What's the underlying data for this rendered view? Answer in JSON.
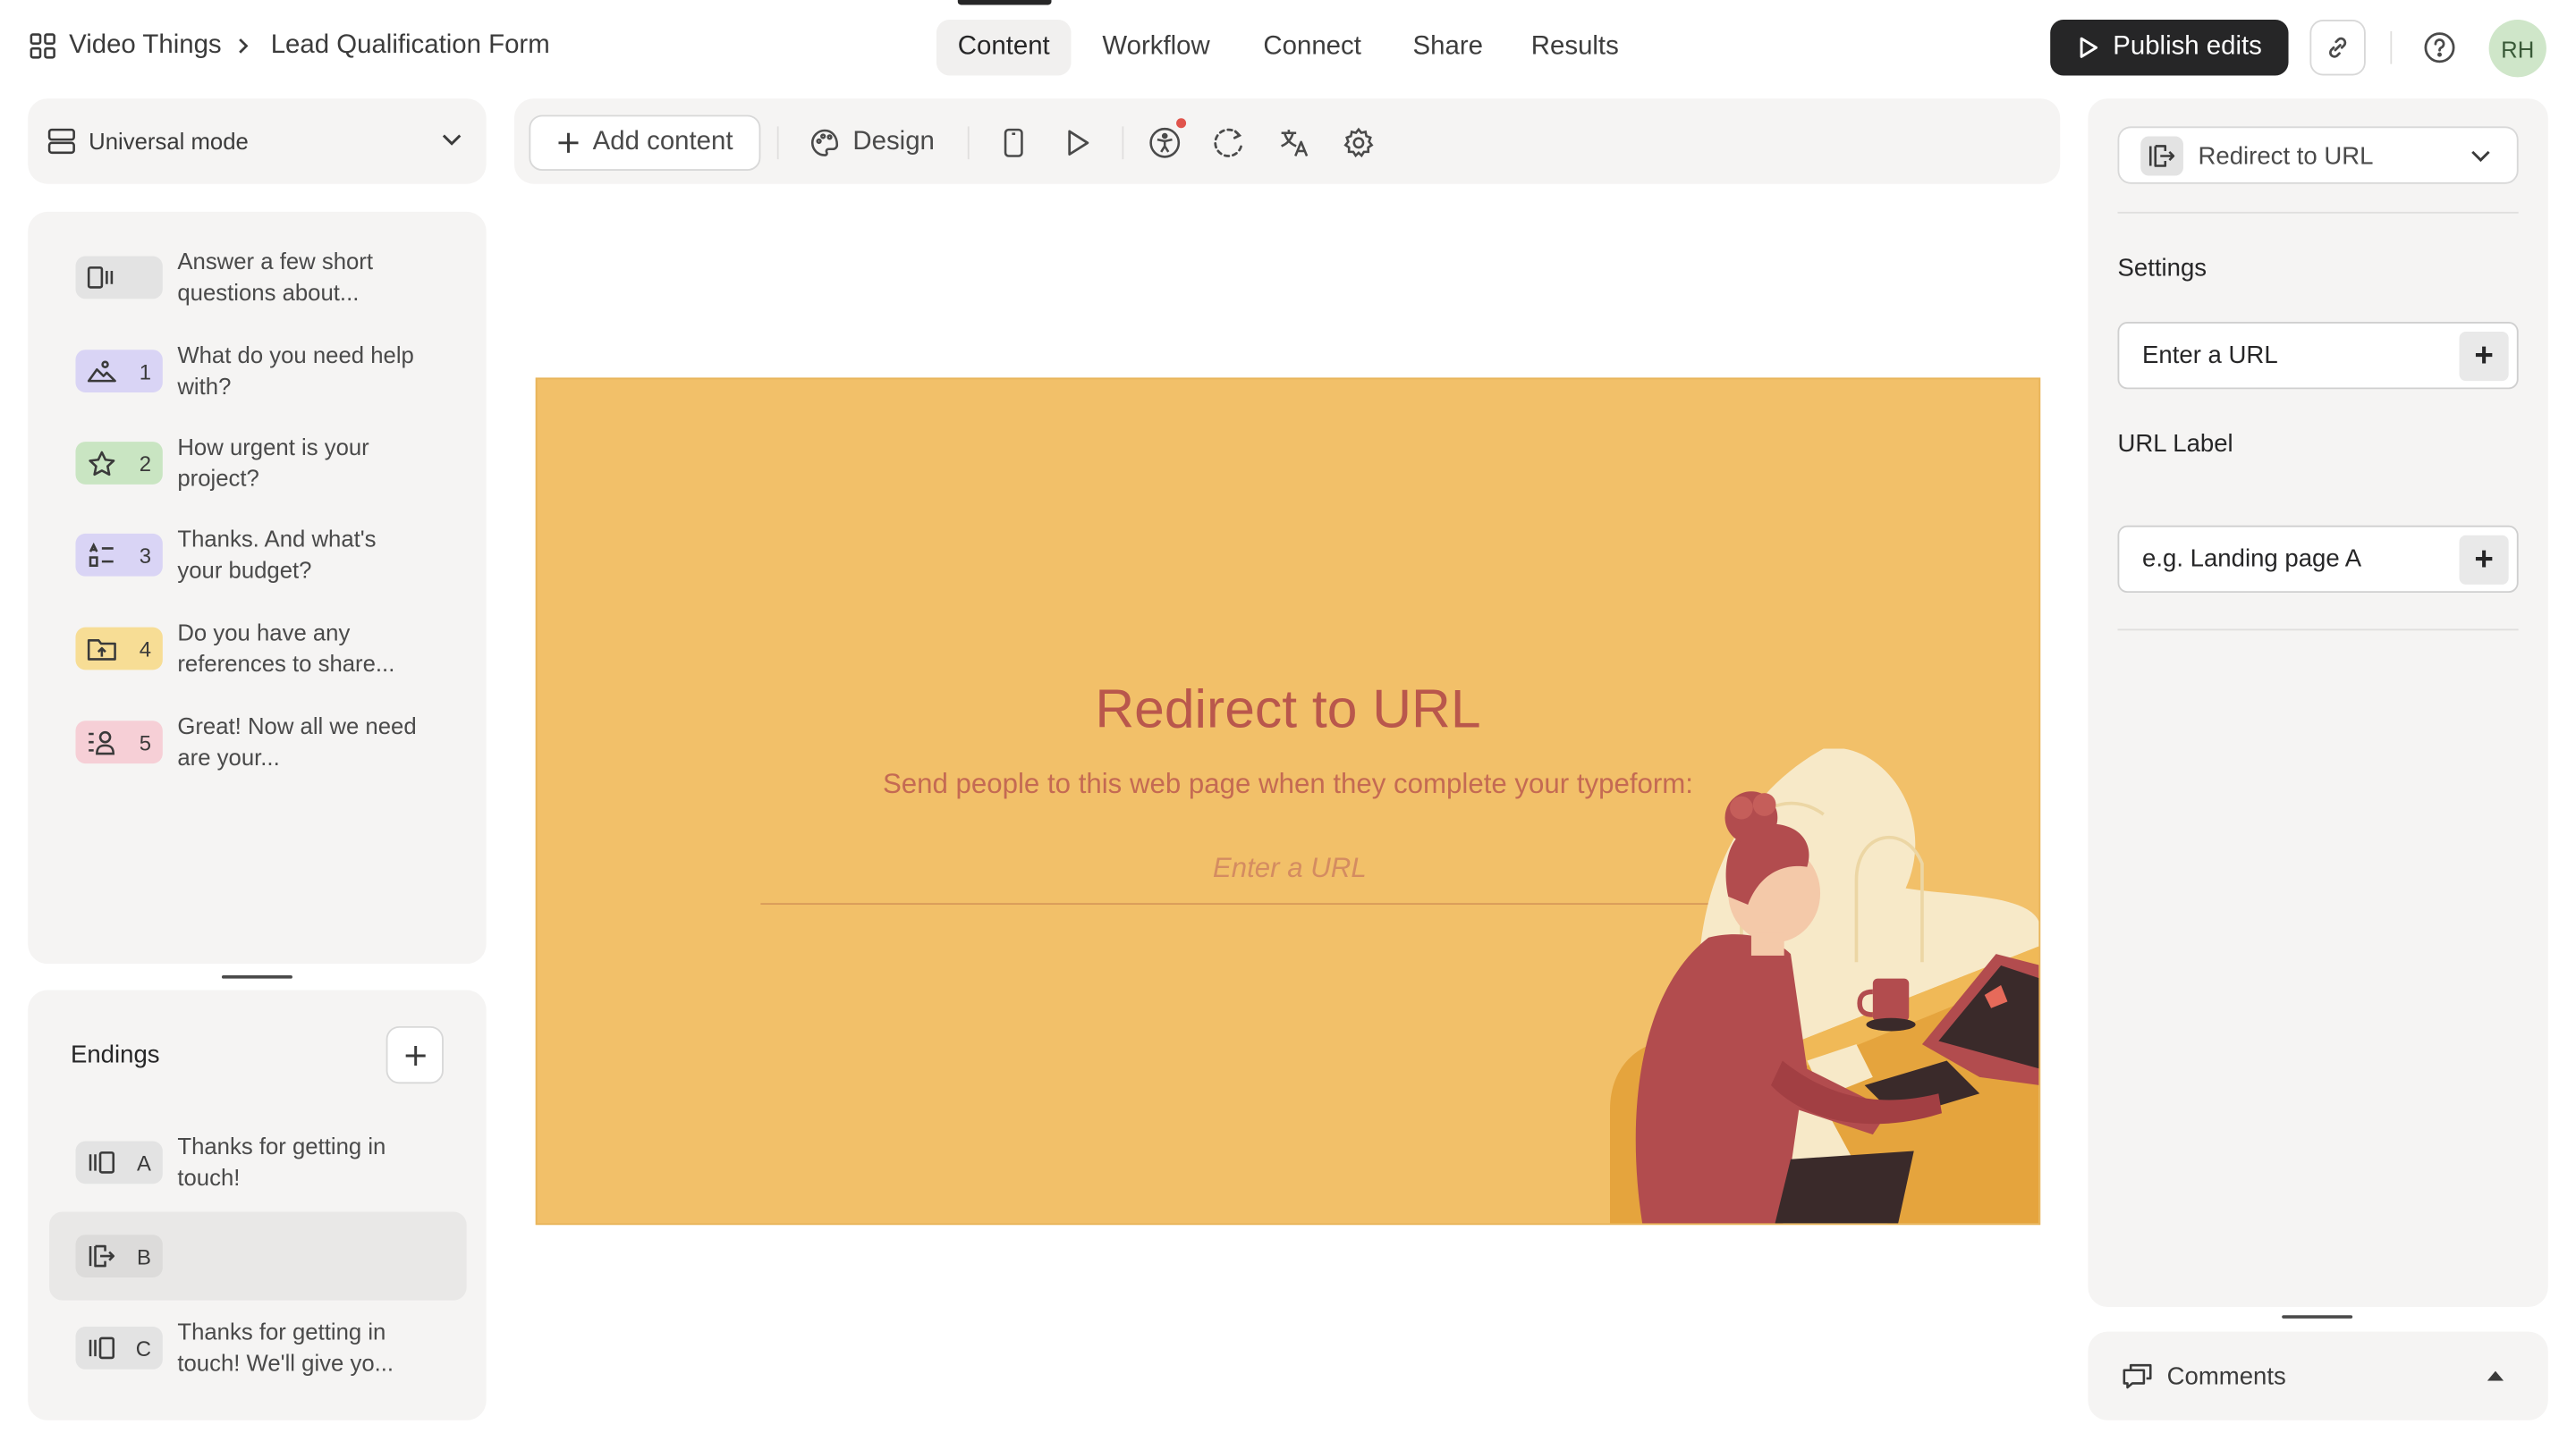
{
  "header": {
    "workspace": "Video Things",
    "form_name": "Lead Qualification Form",
    "tabs": [
      {
        "label": "Content",
        "active": true
      },
      {
        "label": "Workflow"
      },
      {
        "label": "Connect"
      },
      {
        "label": "Share"
      },
      {
        "label": "Results"
      }
    ],
    "publish_label": "Publish edits",
    "avatar_initials": "RH"
  },
  "left": {
    "mode_label": "Universal mode",
    "questions": [
      {
        "number": "",
        "text": "Answer a few short questions about...",
        "icon": "welcome-screen-icon",
        "color": "#e3e3e3"
      },
      {
        "number": "1",
        "text": "What do you need help with?",
        "icon": "picture-choice-icon",
        "color": "#d9d4f5"
      },
      {
        "number": "2",
        "text": "How urgent is your project?",
        "icon": "star-rating-icon",
        "color": "#c9e5c2"
      },
      {
        "number": "3",
        "text": "Thanks. And what's your budget?",
        "icon": "ranking-icon",
        "color": "#d9d4f5"
      },
      {
        "number": "4",
        "text": "Do you have any references to share...",
        "icon": "file-upload-icon",
        "color": "#f7dd95"
      },
      {
        "number": "5",
        "text": "Great! Now all we need are your...",
        "icon": "contact-info-icon",
        "color": "#f6cfd6"
      }
    ],
    "endings_title": "Endings",
    "endings": [
      {
        "letter": "A",
        "text": "Thanks for getting in touch!",
        "icon": "ending-screen-icon"
      },
      {
        "letter": "B",
        "text": "",
        "icon": "redirect-icon",
        "selected": true
      },
      {
        "letter": "C",
        "text": "Thanks for getting in touch! We'll give yo...",
        "icon": "ending-screen-icon"
      }
    ]
  },
  "toolbar": {
    "add_content": "Add content",
    "design": "Design"
  },
  "canvas": {
    "title": "Redirect to URL",
    "subtitle": "Send people to this web page when they complete your typeform:",
    "url_placeholder": "Enter a URL",
    "bg_color": "#f2c069",
    "accent": "#b9574c"
  },
  "right": {
    "type_label": "Redirect to URL",
    "settings_title": "Settings",
    "url_placeholder": "Enter a URL",
    "url_label_title": "URL Label",
    "url_label_placeholder": "e.g. Landing page A",
    "comments_label": "Comments"
  }
}
